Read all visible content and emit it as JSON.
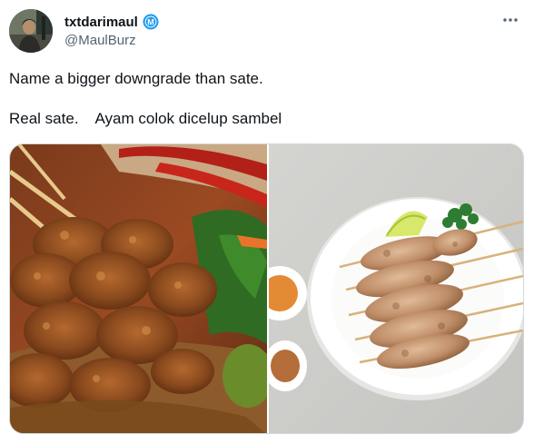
{
  "author": {
    "display_name": "txtdarimaul",
    "handle": "@MaulBurz",
    "verified_badge_letter": "M",
    "verified_color": "#1d9bf0"
  },
  "tweet": {
    "line1": "Name a bigger downgrade than sate.",
    "line2": "Real sate.    Ayam colok dicelup sambel"
  },
  "media": {
    "left_image": "real-sate-peanut-sauce",
    "right_image": "grilled-chicken-skewers-plate"
  },
  "icons": {
    "avatar": "profile-photo",
    "verified": "verified-badge-icon",
    "more": "more-options-icon"
  }
}
